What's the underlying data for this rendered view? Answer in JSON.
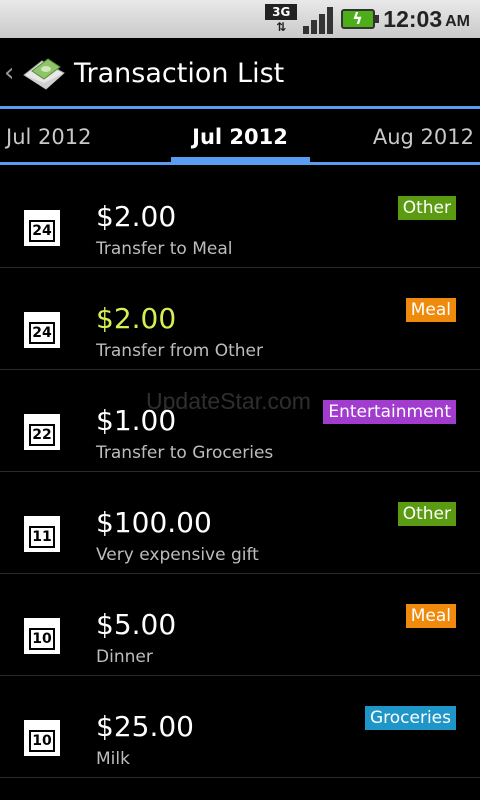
{
  "status_bar": {
    "network": "3G",
    "network_arrows": "⇅",
    "time": "12:03",
    "ampm": "AM"
  },
  "header": {
    "back_glyph": "‹",
    "title": "Transaction List"
  },
  "tabs": {
    "prev": "Jul 2012",
    "current": "Jul 2012",
    "next": "Aug 2012"
  },
  "colors": {
    "accent": "#5a9cf2",
    "income_amount": "#d8ee52",
    "badge_other": "#5a9b11",
    "badge_meal": "#f08a0c",
    "badge_entertainment": "#a13ccf",
    "badge_groceries": "#1f96c8"
  },
  "transactions": [
    {
      "day": "24",
      "amount": "$2.00",
      "description": "Transfer to Meal",
      "category": "Other",
      "amount_color": "#ffffff",
      "badge_color": "#5a9b11"
    },
    {
      "day": "24",
      "amount": "$2.00",
      "description": "Transfer from Other",
      "category": "Meal",
      "amount_color": "#d8ee52",
      "badge_color": "#f08a0c"
    },
    {
      "day": "22",
      "amount": "$1.00",
      "description": "Transfer to Groceries",
      "category": "Entertainment",
      "amount_color": "#ffffff",
      "badge_color": "#a13ccf"
    },
    {
      "day": "11",
      "amount": "$100.00",
      "description": "Very expensive gift",
      "category": "Other",
      "amount_color": "#ffffff",
      "badge_color": "#5a9b11"
    },
    {
      "day": "10",
      "amount": "$5.00",
      "description": "Dinner",
      "category": "Meal",
      "amount_color": "#ffffff",
      "badge_color": "#f08a0c"
    },
    {
      "day": "10",
      "amount": "$25.00",
      "description": "Milk",
      "category": "Groceries",
      "amount_color": "#ffffff",
      "badge_color": "#1f96c8"
    }
  ],
  "watermark": "UpdateStar.com"
}
